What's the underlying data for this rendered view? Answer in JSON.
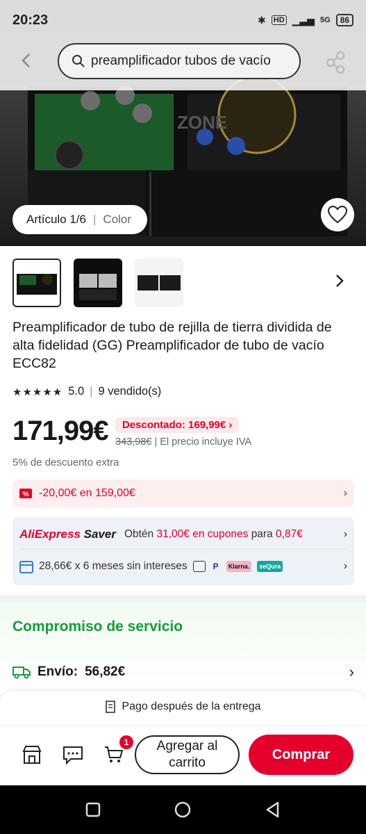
{
  "status": {
    "time": "20:23",
    "hd": "HD",
    "net": "5G",
    "battery": "86"
  },
  "search": {
    "query": "preamplificador tubos de vacío"
  },
  "hero": {
    "article_label": "Artículo 1/6",
    "color_label": "Color",
    "watermark": "ZONE"
  },
  "product": {
    "title": "Preamplificador de tubo de rejilla de tierra dividida de alta fidelidad (GG) Preamplificador de tubo de vacío ECC82",
    "rating": "5.0",
    "sold": "9 vendido(s)",
    "price": "171,99€",
    "discount_badge": "Descontado: 169,99€ ›",
    "original_price": "343,98€",
    "vat_note": "| El precio incluye IVA",
    "extra_discount": "5% de descuento extra"
  },
  "coupon": {
    "text": "-20,00€ en 159,00€"
  },
  "saver": {
    "logo_a": "AliExpress",
    "logo_b": "Saver",
    "text_a": "Obtén",
    "amount": "31,00€ en cupones",
    "text_b": "para",
    "price": "0,87€"
  },
  "installments": {
    "text": "28,66€ x 6 meses sin intereses",
    "klarna": "Klarna.",
    "sequra": "seQura"
  },
  "service": {
    "title": "Compromiso de servicio",
    "shipping_label": "Envío:",
    "shipping_value": "56,82€"
  },
  "bottom": {
    "pay_after": "Pago después de la entrega",
    "cart_count": "1",
    "add_to_cart": "Agregar al carrito",
    "buy": "Comprar"
  },
  "colors": {
    "accent": "#e4002b",
    "green": "#169c3e"
  }
}
